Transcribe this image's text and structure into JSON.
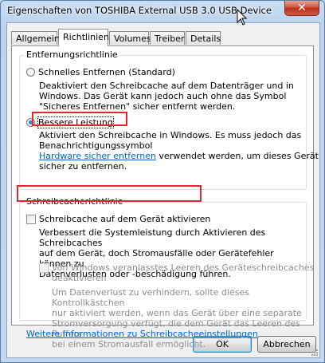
{
  "window": {
    "title": "Eigenschaften von TOSHIBA External USB 3.0 USB Device",
    "close_glyph": "✕"
  },
  "tabs": [
    {
      "label": "Allgemein",
      "active": false
    },
    {
      "label": "Richtlinien",
      "active": true
    },
    {
      "label": "Volumes",
      "active": false
    },
    {
      "label": "Treiber",
      "active": false
    },
    {
      "label": "Details",
      "active": false
    }
  ],
  "removal_policy": {
    "legend": "Entfernungsrichtlinie",
    "quick_removal": {
      "label": "Schnelles Entfernen (Standard)",
      "checked": false,
      "desc_lines": [
        "Deaktiviert den Schreibcache auf dem Datenträger und in",
        "Windows. Das Gerät kann jedoch auch ohne das Symbol",
        "\"Sicheres Entfernen\" sicher entfernt werden."
      ]
    },
    "better_performance": {
      "label": "Bessere Leistung",
      "checked": true,
      "desc_lines": [
        "Aktiviert den Schreibcache in Windows. Es muss jedoch das",
        "Benachrichtigungssymbol"
      ],
      "link_text": "Hardware sicher entfernen",
      "after_link_text": " verwendet werden, um dieses Gerät",
      "last_line": "sicher zu entfernen."
    }
  },
  "write_cache_policy": {
    "legend": "Schreibcacherichtlinie",
    "enable_write_cache": {
      "label": "Schreibcache auf dem Gerät aktivieren",
      "checked": false,
      "desc_lines": [
        "Verbessert die Systemleistung durch Aktivieren des Schreibcaches",
        "auf dem Gerät, doch Stromausfälle oder Gerätefehler können zu",
        "Datenverlusten oder -beschädigung führen."
      ]
    },
    "disable_flushing": {
      "label_line1": "Von Windows veranlasstes Leeren des Geräteschreibcaches",
      "label_line2": "deaktivieren",
      "checked": false,
      "enabled": false,
      "desc_lines": [
        "Um Datenverlust zu verhindern, sollte dieses Kontrollkästchen",
        "nur aktiviert werden, wenn das Gerät über eine separate",
        "Stromversorgung verfügt, die dem Gerät das Leeren des Puffers",
        "bei einem Stromausfall ermöglicht."
      ]
    },
    "more_info_link": "Weitere Informationen zu Schreibcacheeinstellungen"
  },
  "buttons": {
    "ok": "OK",
    "cancel": "Abbrechen"
  },
  "colors": {
    "highlight": "#e8242d",
    "link": "#0066cc"
  }
}
